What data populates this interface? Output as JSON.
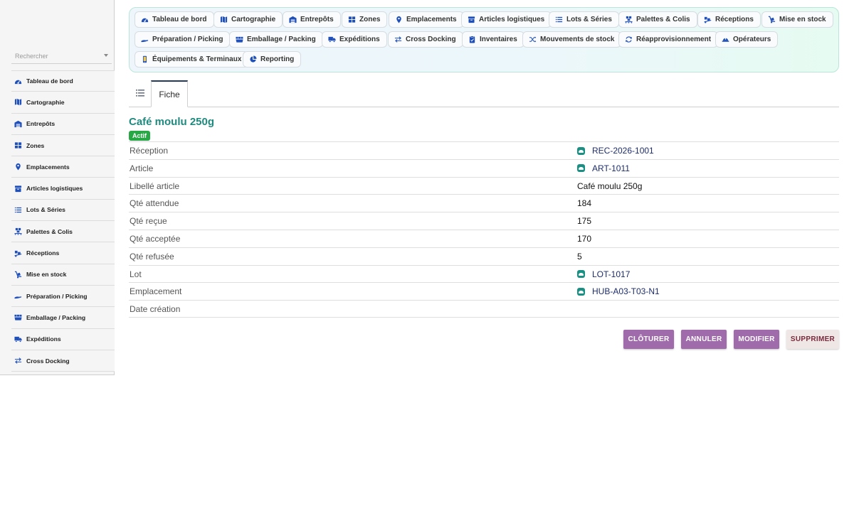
{
  "sidebar": {
    "search_placeholder": "Rechercher",
    "items": [
      {
        "label": "Tableau de bord",
        "icon": "dashboard-icon"
      },
      {
        "label": "Cartographie",
        "icon": "map-icon"
      },
      {
        "label": "Entrepôts",
        "icon": "warehouse-icon"
      },
      {
        "label": "Zones",
        "icon": "grid-icon"
      },
      {
        "label": "Emplacements",
        "icon": "map-pin-icon"
      },
      {
        "label": "Articles logistiques",
        "icon": "box-icon"
      },
      {
        "label": "Lots & Séries",
        "icon": "list-icon"
      },
      {
        "label": "Palettes & Colis",
        "icon": "pallet-icon"
      },
      {
        "label": "Réceptions",
        "icon": "truck-loading-icon"
      },
      {
        "label": "Mise en stock",
        "icon": "dolly-icon"
      },
      {
        "label": "Préparation / Picking",
        "icon": "hand-icon"
      },
      {
        "label": "Emballage / Packing",
        "icon": "boxes-icon"
      },
      {
        "label": "Expéditions",
        "icon": "truck-icon"
      },
      {
        "label": "Cross Docking",
        "icon": "exchange-icon"
      }
    ]
  },
  "modules": [
    {
      "label": "Tableau de bord",
      "icon": "dashboard-icon"
    },
    {
      "label": "Cartographie",
      "icon": "map-icon"
    },
    {
      "label": "Entrepôts",
      "icon": "warehouse-icon"
    },
    {
      "label": "Zones",
      "icon": "grid-icon"
    },
    {
      "label": "Emplacements",
      "icon": "map-pin-icon"
    },
    {
      "label": "Articles logistiques",
      "icon": "box-icon"
    },
    {
      "label": "Lots & Séries",
      "icon": "list-icon"
    },
    {
      "label": "Palettes & Colis",
      "icon": "pallet-icon"
    },
    {
      "label": "Réceptions",
      "icon": "truck-loading-icon"
    },
    {
      "label": "Mise en stock",
      "icon": "dolly-icon"
    },
    {
      "label": "Préparation / Picking",
      "icon": "hand-icon"
    },
    {
      "label": "Emballage / Packing",
      "icon": "boxes-icon"
    },
    {
      "label": "Expéditions",
      "icon": "truck-icon"
    },
    {
      "label": "Cross Docking",
      "icon": "exchange-icon"
    },
    {
      "label": "Inventaires",
      "icon": "clipboard-icon"
    },
    {
      "label": "Mouvements de stock",
      "icon": "shuffle-icon"
    },
    {
      "label": "Réapprovisionnement",
      "icon": "refresh-icon"
    },
    {
      "label": "Opérateurs",
      "icon": "hard-hat-icon"
    },
    {
      "label": "Équipements & Terminaux",
      "icon": "mobile-icon"
    },
    {
      "label": "Reporting",
      "icon": "pie-chart-icon"
    }
  ],
  "tabs": {
    "list_icon": "list-view-icon",
    "fiche_label": "Fiche"
  },
  "record": {
    "title": "Café moulu 250g",
    "status": "Actif",
    "fields": [
      {
        "label": "Réception",
        "value": "REC-2026-1001",
        "link": true
      },
      {
        "label": "Article",
        "value": "ART-1011",
        "link": true
      },
      {
        "label": "Libellé article",
        "value": "Café moulu 250g",
        "link": false
      },
      {
        "label": "Qté attendue",
        "value": "184",
        "link": false
      },
      {
        "label": "Qté reçue",
        "value": "175",
        "link": false
      },
      {
        "label": "Qté acceptée",
        "value": "170",
        "link": false
      },
      {
        "label": "Qté refusée",
        "value": "5",
        "link": false
      },
      {
        "label": "Lot",
        "value": "LOT-1017",
        "link": true
      },
      {
        "label": "Emplacement",
        "value": "HUB-A03-T03-N1",
        "link": true
      },
      {
        "label": "Date création",
        "value": "",
        "link": false
      }
    ]
  },
  "actions": {
    "cloturer": "CLÔTURER",
    "annuler": "ANNULER",
    "modifier": "MODIFIER",
    "supprimer": "SUPPRIMER"
  },
  "colors": {
    "title_teal": "#1f8a7e",
    "badge_green": "#28a745",
    "action_purple": "#a06baa",
    "link_navy": "#1d2d6b",
    "icon_blue": "#1f4fb8"
  }
}
